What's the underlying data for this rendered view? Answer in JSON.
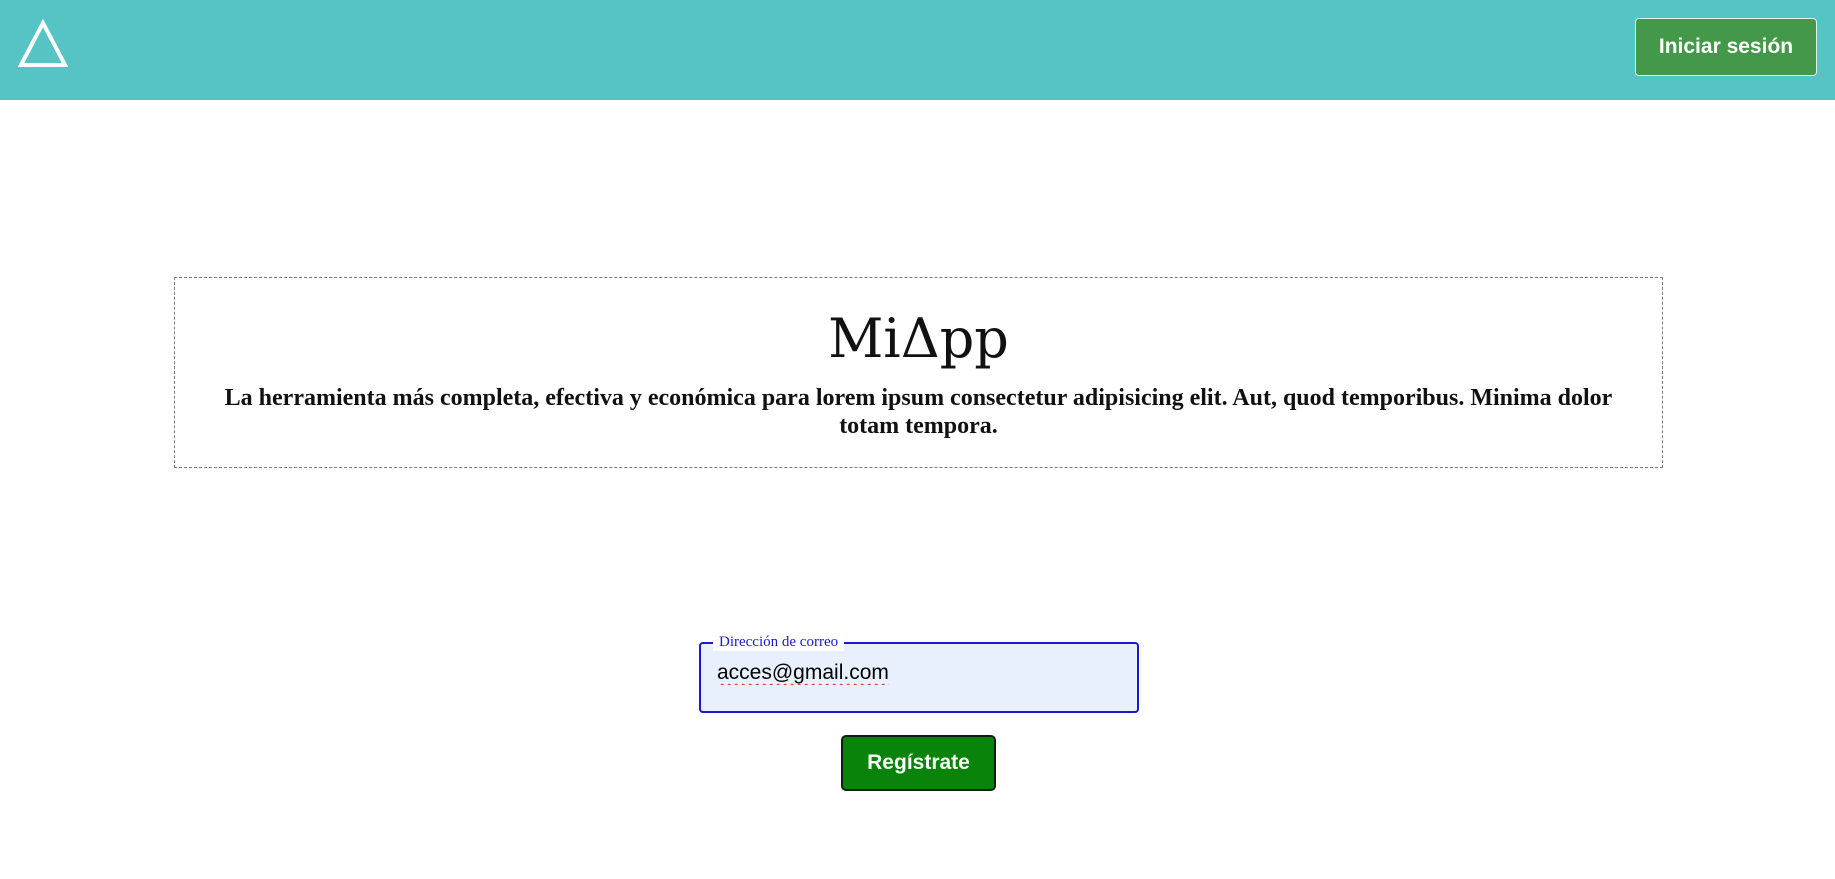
{
  "header": {
    "logo_icon": "delta-triangle-icon",
    "background_color": "#56c3c5",
    "login_label": "Iniciar sesión",
    "login_color": "#43984a"
  },
  "hero": {
    "title": "MiΔpp",
    "tagline": "La herramienta más completa, efectiva y económica para lorem ipsum consectetur adipisicing elit. Aut, quod temporibus. Minima dolor totam tempora."
  },
  "signup": {
    "email_legend": "Dirección de correo",
    "email_value": "acces@gmail.com",
    "register_label": "Regístrate",
    "register_color": "#0a830a",
    "focus_color": "#1a1acc"
  }
}
